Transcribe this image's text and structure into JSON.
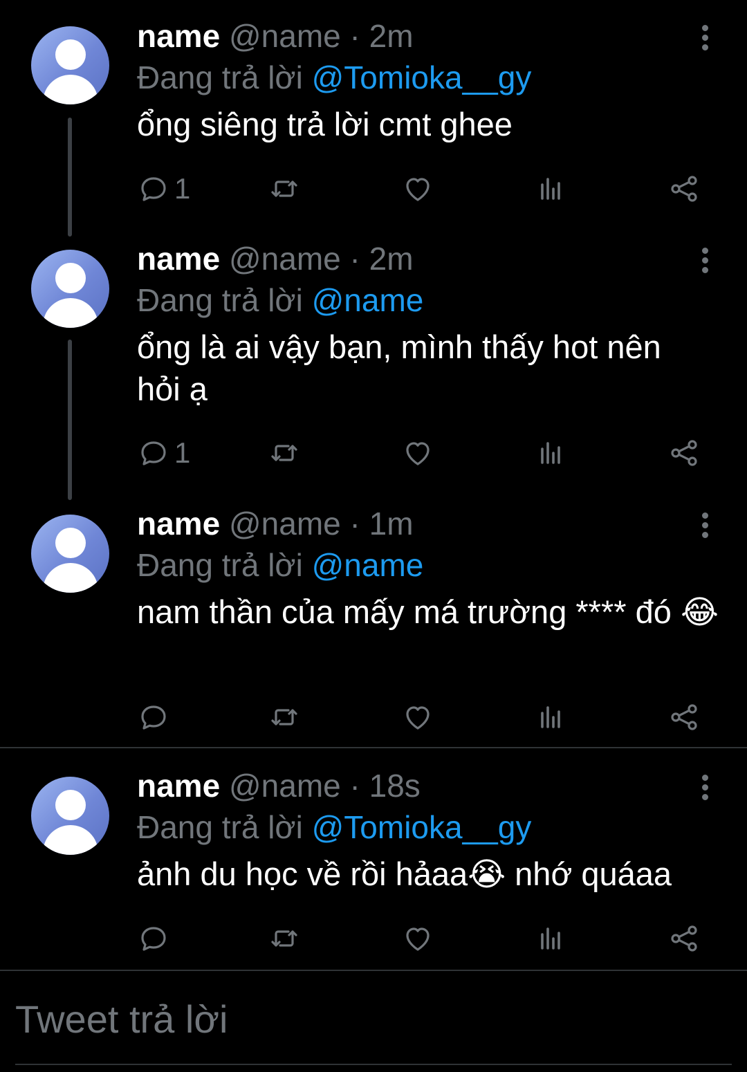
{
  "tweets": [
    {
      "name": "name",
      "handle": "@name",
      "separator": "·",
      "time": "2m",
      "replying_prefix": "Đang trả lời",
      "replying_to": "@Tomioka__gy",
      "text": "ổng siêng trả lời cmt ghee",
      "reply_count": "1"
    },
    {
      "name": "name",
      "handle": "@name",
      "separator": "·",
      "time": "2m",
      "replying_prefix": "Đang trả lời",
      "replying_to": "@name",
      "text": "ổng là ai vậy bạn, mình thấy hot nên hỏi ạ",
      "reply_count": "1"
    },
    {
      "name": "name",
      "handle": "@name",
      "separator": "·",
      "time": "1m",
      "replying_prefix": "Đang trả lời",
      "replying_to": "@name",
      "text": "nam thần của mấy má trường **** đó 😂",
      "reply_count": ""
    },
    {
      "name": "name",
      "handle": "@name",
      "separator": "·",
      "time": "18s",
      "replying_prefix": "Đang trả lời",
      "replying_to": "@Tomioka__gy",
      "text": "ảnh du học về rồi hảaa😭 nhớ quáaa",
      "reply_count": ""
    }
  ],
  "compose": {
    "placeholder": "Tweet trả lời"
  },
  "icons": {
    "reply": "reply-icon",
    "retweet": "retweet-icon",
    "like": "heart-icon",
    "views": "views-icon",
    "share": "share-icon",
    "more": "more-vertical-icon"
  },
  "colors": {
    "background": "#000000",
    "text": "#ffffff",
    "secondary": "#71767b",
    "mention": "#1d9bf0",
    "divider": "#2f3336",
    "thread_line": "#3c4045"
  }
}
